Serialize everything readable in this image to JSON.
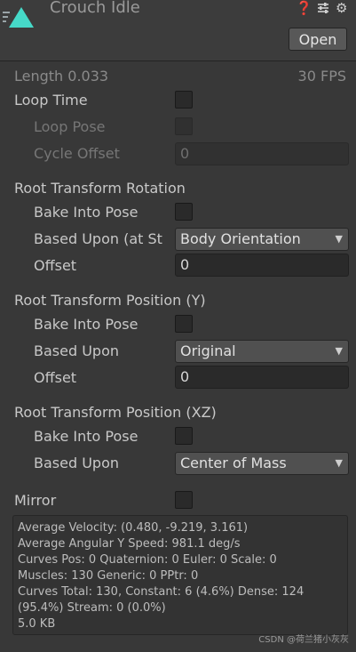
{
  "header": {
    "title": "Crouch Idle",
    "open_label": "Open",
    "icons": [
      "animation-clip-icon",
      "help-icon",
      "presets-icon",
      "settings-icon"
    ]
  },
  "info": {
    "length": "Length  0.033",
    "fps": "30 FPS"
  },
  "loop": {
    "loop_time": "Loop Time",
    "loop_pose": "Loop Pose",
    "cycle_offset": "Cycle Offset",
    "cycle_offset_value": "0"
  },
  "rotation": {
    "heading": "Root Transform Rotation",
    "bake": "Bake Into Pose",
    "based_upon": "Based Upon (at St",
    "based_upon_value": "Body Orientation",
    "offset": "Offset",
    "offset_value": "0"
  },
  "position_y": {
    "heading": "Root Transform Position (Y)",
    "bake": "Bake Into Pose",
    "based_upon": "Based Upon",
    "based_upon_value": "Original",
    "offset": "Offset",
    "offset_value": "0"
  },
  "position_xz": {
    "heading": "Root Transform Position (XZ)",
    "bake": "Bake Into Pose",
    "based_upon": "Based Upon",
    "based_upon_value": "Center of Mass"
  },
  "mirror": {
    "label": "Mirror"
  },
  "stats": [
    "Average Velocity: (0.480, -9.219, 3.161)",
    "Average Angular Y Speed: 981.1 deg/s",
    "Curves Pos: 0 Quaternion: 0 Euler: 0 Scale: 0",
    "Muscles: 130 Generic: 0 PPtr: 0",
    "Curves Total: 130, Constant: 6 (4.6%) Dense: 124",
    "(95.4%) Stream: 0 (0.0%)",
    "5.0 KB"
  ],
  "watermark": "CSDN @荷兰猪小灰灰"
}
